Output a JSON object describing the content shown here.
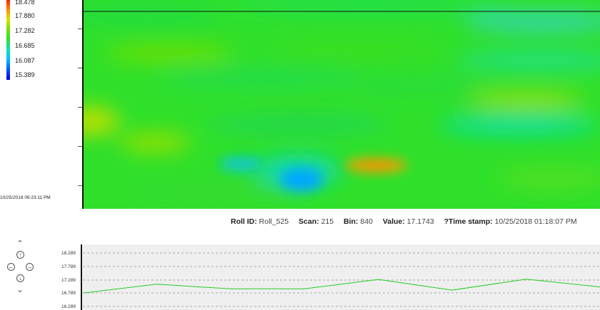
{
  "legend": {
    "labels": [
      "18.478",
      "17.880",
      "17.282",
      "16.685",
      "16.087",
      "15.389"
    ]
  },
  "left_timestamp": "10/25/2018 06:23:11 PM",
  "status": {
    "roll_id_label": "Roll ID:",
    "roll_id_value": "Roll_525",
    "scan_label": "Scan:",
    "scan_value": "215",
    "bin_label": "Bin:",
    "bin_value": "840",
    "value_label": "Value:",
    "value_value": "17.1743",
    "timestamp_label": "?Time stamp:",
    "timestamp_value": "10/25/2018 01:18:07 PM"
  },
  "nav": {
    "icons": [
      "chevron-double-up-icon",
      "arrow-up-circle-icon",
      "arrow-left-circle-icon",
      "arrow-right-circle-icon",
      "arrow-down-circle-icon",
      "chevron-double-down-icon"
    ]
  },
  "trend": {
    "tick_labels": [
      "18.289",
      "17.789",
      "17.289",
      "16.789",
      "16.289"
    ],
    "line_color": "#22cc22",
    "values": [
      16.79,
      17.12,
      16.95,
      16.95,
      17.3,
      16.9,
      17.31,
      17.02
    ]
  },
  "colors": {
    "heatmap_base": "#2ee02e",
    "hot": "#ff9900",
    "cool": "#00b8ff",
    "frame": "#111111"
  }
}
